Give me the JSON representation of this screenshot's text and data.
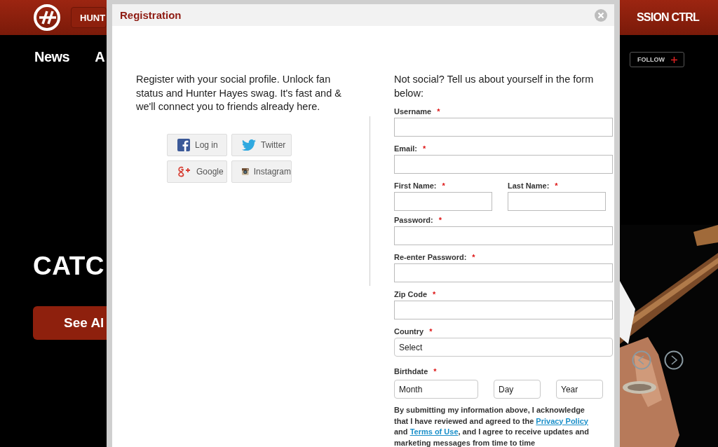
{
  "site": {
    "header_button": "HUNT",
    "header_right": "SSION CTRL",
    "nav": [
      "News",
      "A"
    ],
    "follow_button": "FOLLOW",
    "hero_title": "CATC",
    "hero_button": "See Al"
  },
  "modal": {
    "title": "Registration",
    "social_intro": "Register with your social profile. Unlock fan status and Hunter Hayes swag. It's fast and & we'll connect you to friends already here.",
    "social_buttons": [
      {
        "kind": "facebook",
        "label": "Log in"
      },
      {
        "kind": "twitter",
        "label": "Twitter"
      },
      {
        "kind": "google",
        "label": "Google"
      },
      {
        "kind": "instagram",
        "label": "Instagram"
      }
    ],
    "form_intro": "Not social? Tell us about yourself in the form below:",
    "rows": [
      {
        "kind": "full",
        "fields": [
          {
            "label": "Username",
            "required_mark": "*"
          }
        ]
      },
      {
        "kind": "full",
        "fields": [
          {
            "label": "Email:",
            "required_mark": "*"
          }
        ]
      },
      {
        "kind": "pair",
        "fields": [
          {
            "label": "First Name:",
            "required_mark": "*"
          },
          {
            "label": "Last Name:",
            "required_mark": "*"
          }
        ]
      },
      {
        "kind": "full",
        "fields": [
          {
            "label": "Password:",
            "required_mark": "*"
          }
        ]
      },
      {
        "kind": "full",
        "fields": [
          {
            "label": "Re-enter Password:",
            "required_mark": "*"
          }
        ]
      },
      {
        "kind": "full",
        "fields": [
          {
            "label": "Zip Code",
            "required_mark": "*"
          }
        ]
      },
      {
        "kind": "select",
        "fields": [
          {
            "label": "Country",
            "required_mark": "*",
            "value": "Select"
          }
        ]
      },
      {
        "kind": "date",
        "fields": [
          {
            "label": "Birthdate",
            "required_mark": "*",
            "parts": [
              "Month",
              "Day",
              "Year"
            ]
          }
        ]
      }
    ],
    "terms": [
      {
        "kind": "text",
        "text": "By submitting my information above, I acknowledge that I have reviewed and agreed to the "
      },
      {
        "kind": "link",
        "text": "Privacy Policy"
      },
      {
        "kind": "text",
        "text": " and "
      },
      {
        "kind": "link",
        "text": "Terms of Use"
      },
      {
        "kind": "text",
        "text": ", and I agree to receive updates and marketing messages from time to time"
      }
    ]
  }
}
